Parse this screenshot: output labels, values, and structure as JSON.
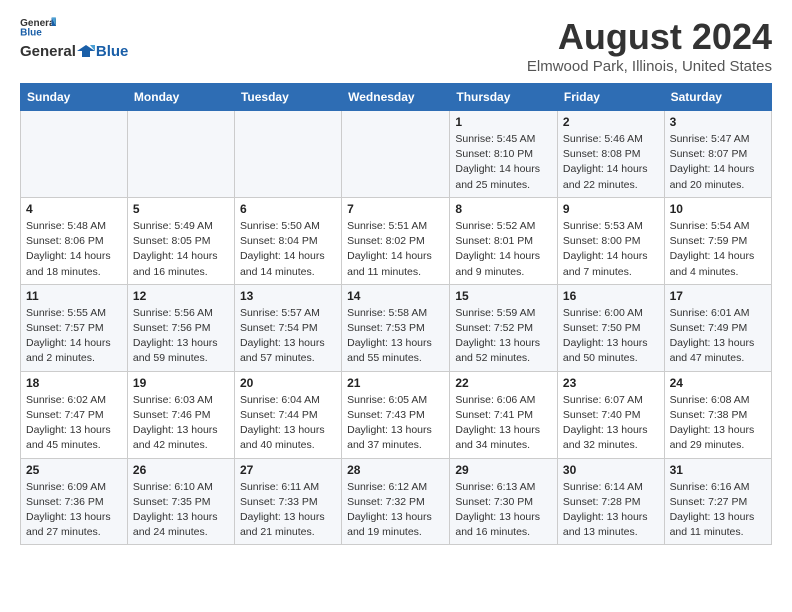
{
  "header": {
    "logo_line1": "General",
    "logo_line2": "Blue",
    "month": "August 2024",
    "location": "Elmwood Park, Illinois, United States"
  },
  "weekdays": [
    "Sunday",
    "Monday",
    "Tuesday",
    "Wednesday",
    "Thursday",
    "Friday",
    "Saturday"
  ],
  "weeks": [
    [
      {
        "day": "",
        "sunrise": "",
        "sunset": "",
        "daylight": ""
      },
      {
        "day": "",
        "sunrise": "",
        "sunset": "",
        "daylight": ""
      },
      {
        "day": "",
        "sunrise": "",
        "sunset": "",
        "daylight": ""
      },
      {
        "day": "",
        "sunrise": "",
        "sunset": "",
        "daylight": ""
      },
      {
        "day": "1",
        "sunrise": "Sunrise: 5:45 AM",
        "sunset": "Sunset: 8:10 PM",
        "daylight": "Daylight: 14 hours and 25 minutes."
      },
      {
        "day": "2",
        "sunrise": "Sunrise: 5:46 AM",
        "sunset": "Sunset: 8:08 PM",
        "daylight": "Daylight: 14 hours and 22 minutes."
      },
      {
        "day": "3",
        "sunrise": "Sunrise: 5:47 AM",
        "sunset": "Sunset: 8:07 PM",
        "daylight": "Daylight: 14 hours and 20 minutes."
      }
    ],
    [
      {
        "day": "4",
        "sunrise": "Sunrise: 5:48 AM",
        "sunset": "Sunset: 8:06 PM",
        "daylight": "Daylight: 14 hours and 18 minutes."
      },
      {
        "day": "5",
        "sunrise": "Sunrise: 5:49 AM",
        "sunset": "Sunset: 8:05 PM",
        "daylight": "Daylight: 14 hours and 16 minutes."
      },
      {
        "day": "6",
        "sunrise": "Sunrise: 5:50 AM",
        "sunset": "Sunset: 8:04 PM",
        "daylight": "Daylight: 14 hours and 14 minutes."
      },
      {
        "day": "7",
        "sunrise": "Sunrise: 5:51 AM",
        "sunset": "Sunset: 8:02 PM",
        "daylight": "Daylight: 14 hours and 11 minutes."
      },
      {
        "day": "8",
        "sunrise": "Sunrise: 5:52 AM",
        "sunset": "Sunset: 8:01 PM",
        "daylight": "Daylight: 14 hours and 9 minutes."
      },
      {
        "day": "9",
        "sunrise": "Sunrise: 5:53 AM",
        "sunset": "Sunset: 8:00 PM",
        "daylight": "Daylight: 14 hours and 7 minutes."
      },
      {
        "day": "10",
        "sunrise": "Sunrise: 5:54 AM",
        "sunset": "Sunset: 7:59 PM",
        "daylight": "Daylight: 14 hours and 4 minutes."
      }
    ],
    [
      {
        "day": "11",
        "sunrise": "Sunrise: 5:55 AM",
        "sunset": "Sunset: 7:57 PM",
        "daylight": "Daylight: 14 hours and 2 minutes."
      },
      {
        "day": "12",
        "sunrise": "Sunrise: 5:56 AM",
        "sunset": "Sunset: 7:56 PM",
        "daylight": "Daylight: 13 hours and 59 minutes."
      },
      {
        "day": "13",
        "sunrise": "Sunrise: 5:57 AM",
        "sunset": "Sunset: 7:54 PM",
        "daylight": "Daylight: 13 hours and 57 minutes."
      },
      {
        "day": "14",
        "sunrise": "Sunrise: 5:58 AM",
        "sunset": "Sunset: 7:53 PM",
        "daylight": "Daylight: 13 hours and 55 minutes."
      },
      {
        "day": "15",
        "sunrise": "Sunrise: 5:59 AM",
        "sunset": "Sunset: 7:52 PM",
        "daylight": "Daylight: 13 hours and 52 minutes."
      },
      {
        "day": "16",
        "sunrise": "Sunrise: 6:00 AM",
        "sunset": "Sunset: 7:50 PM",
        "daylight": "Daylight: 13 hours and 50 minutes."
      },
      {
        "day": "17",
        "sunrise": "Sunrise: 6:01 AM",
        "sunset": "Sunset: 7:49 PM",
        "daylight": "Daylight: 13 hours and 47 minutes."
      }
    ],
    [
      {
        "day": "18",
        "sunrise": "Sunrise: 6:02 AM",
        "sunset": "Sunset: 7:47 PM",
        "daylight": "Daylight: 13 hours and 45 minutes."
      },
      {
        "day": "19",
        "sunrise": "Sunrise: 6:03 AM",
        "sunset": "Sunset: 7:46 PM",
        "daylight": "Daylight: 13 hours and 42 minutes."
      },
      {
        "day": "20",
        "sunrise": "Sunrise: 6:04 AM",
        "sunset": "Sunset: 7:44 PM",
        "daylight": "Daylight: 13 hours and 40 minutes."
      },
      {
        "day": "21",
        "sunrise": "Sunrise: 6:05 AM",
        "sunset": "Sunset: 7:43 PM",
        "daylight": "Daylight: 13 hours and 37 minutes."
      },
      {
        "day": "22",
        "sunrise": "Sunrise: 6:06 AM",
        "sunset": "Sunset: 7:41 PM",
        "daylight": "Daylight: 13 hours and 34 minutes."
      },
      {
        "day": "23",
        "sunrise": "Sunrise: 6:07 AM",
        "sunset": "Sunset: 7:40 PM",
        "daylight": "Daylight: 13 hours and 32 minutes."
      },
      {
        "day": "24",
        "sunrise": "Sunrise: 6:08 AM",
        "sunset": "Sunset: 7:38 PM",
        "daylight": "Daylight: 13 hours and 29 minutes."
      }
    ],
    [
      {
        "day": "25",
        "sunrise": "Sunrise: 6:09 AM",
        "sunset": "Sunset: 7:36 PM",
        "daylight": "Daylight: 13 hours and 27 minutes."
      },
      {
        "day": "26",
        "sunrise": "Sunrise: 6:10 AM",
        "sunset": "Sunset: 7:35 PM",
        "daylight": "Daylight: 13 hours and 24 minutes."
      },
      {
        "day": "27",
        "sunrise": "Sunrise: 6:11 AM",
        "sunset": "Sunset: 7:33 PM",
        "daylight": "Daylight: 13 hours and 21 minutes."
      },
      {
        "day": "28",
        "sunrise": "Sunrise: 6:12 AM",
        "sunset": "Sunset: 7:32 PM",
        "daylight": "Daylight: 13 hours and 19 minutes."
      },
      {
        "day": "29",
        "sunrise": "Sunrise: 6:13 AM",
        "sunset": "Sunset: 7:30 PM",
        "daylight": "Daylight: 13 hours and 16 minutes."
      },
      {
        "day": "30",
        "sunrise": "Sunrise: 6:14 AM",
        "sunset": "Sunset: 7:28 PM",
        "daylight": "Daylight: 13 hours and 13 minutes."
      },
      {
        "day": "31",
        "sunrise": "Sunrise: 6:16 AM",
        "sunset": "Sunset: 7:27 PM",
        "daylight": "Daylight: 13 hours and 11 minutes."
      }
    ]
  ]
}
